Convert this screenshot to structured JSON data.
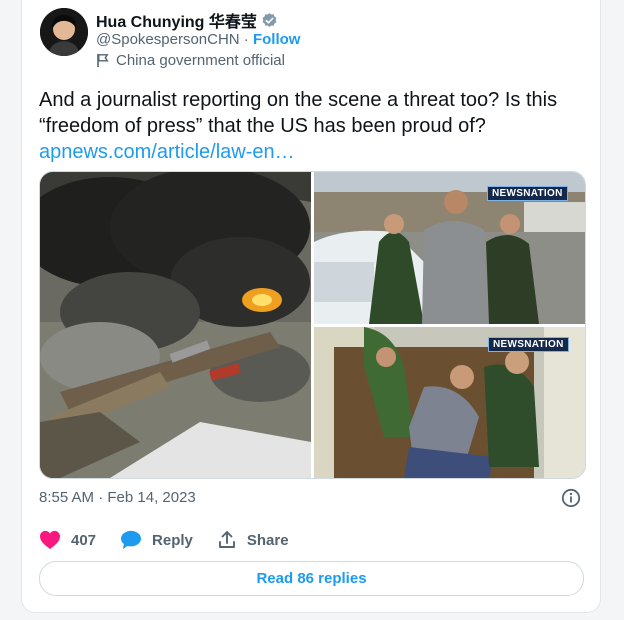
{
  "author": {
    "display_name": "Hua Chunying 华春莹",
    "handle": "@SpokespersonCHN",
    "separator": "·",
    "follow_label": "Follow",
    "account_label": "China government official"
  },
  "tweet": {
    "text": "And a journalist reporting on the scene a threat too? Is this “freedom of press” that the US has been proud of?",
    "link": "apnews.com/article/law-en…",
    "media": {
      "badge_top": "NEWSNATION",
      "badge_bottom": "NEWSNATION"
    },
    "timestamp": "8:55 AM · Feb 14, 2023"
  },
  "actions": {
    "likes_count": "407",
    "reply_label": "Reply",
    "share_label": "Share"
  },
  "read_replies_label": "Read 86 replies",
  "colors": {
    "link": "#1d9bf0",
    "heart": "#f91880",
    "verified": "#829aab",
    "muted_text": "#536471"
  }
}
